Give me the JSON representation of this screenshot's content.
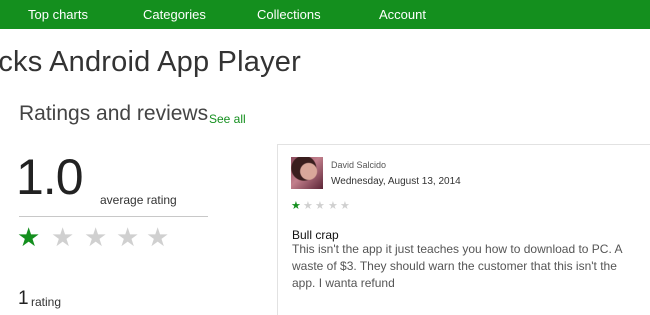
{
  "nav": {
    "items": [
      {
        "label": "Top charts"
      },
      {
        "label": "Categories"
      },
      {
        "label": "Collections"
      },
      {
        "label": "Account"
      }
    ]
  },
  "app": {
    "title": "acks Android App Player"
  },
  "ratings": {
    "heading": "Ratings and reviews",
    "see_all": "See all",
    "average_value": "1.0",
    "average_label": "average rating",
    "average_stars": 1,
    "max_stars": 5,
    "count": "1",
    "count_label": "rating"
  },
  "review": {
    "reviewer": "David Salcido",
    "date": "Wednesday, August 13, 2014",
    "stars": 1,
    "max_stars": 5,
    "title": "Bull crap",
    "body": "This isn't the app it just teaches you how to download to PC. A waste of $3. They should warn the customer that this isn't the app. I wanta refund"
  },
  "colors": {
    "accent": "#148f1e",
    "star_filled": "#148f1e",
    "star_empty": "#d0d0d0"
  }
}
